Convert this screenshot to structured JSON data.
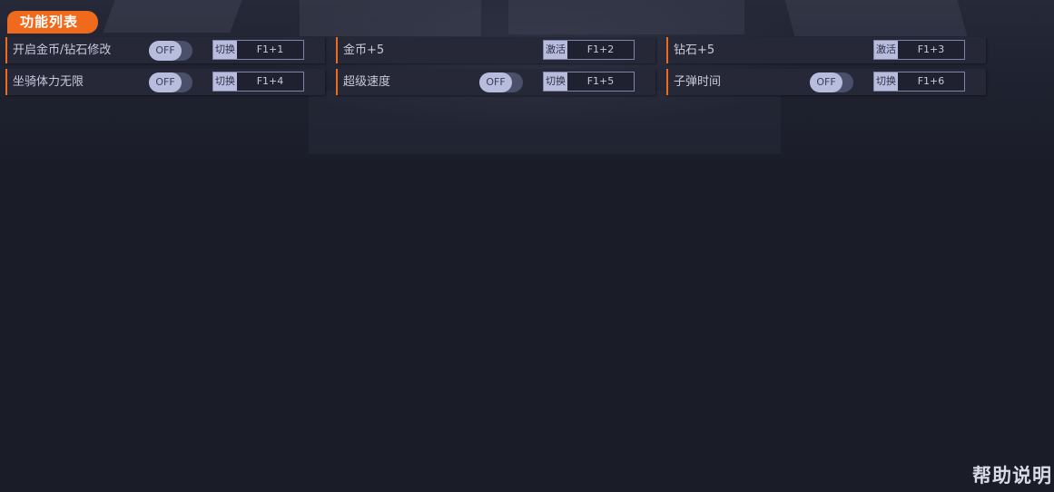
{
  "panel": {
    "title": "功能列表"
  },
  "features": [
    {
      "label": "开启金币/钻石修改",
      "has_toggle": true,
      "toggle_text": "OFF",
      "hotkey_action": "切换",
      "hotkey": "F1+1"
    },
    {
      "label": "金币+5",
      "has_toggle": false,
      "hotkey_action": "激活",
      "hotkey": "F1+2"
    },
    {
      "label": "钻石+5",
      "has_toggle": false,
      "hotkey_action": "激活",
      "hotkey": "F1+3"
    },
    {
      "label": "坐骑体力无限",
      "has_toggle": true,
      "toggle_text": "OFF",
      "hotkey_action": "切换",
      "hotkey": "F1+4"
    },
    {
      "label": "超级速度",
      "has_toggle": true,
      "toggle_text": "OFF",
      "hotkey_action": "切换",
      "hotkey": "F1+5"
    },
    {
      "label": "子弹时间",
      "has_toggle": true,
      "toggle_text": "OFF",
      "hotkey_action": "切换",
      "hotkey": "F1+6"
    }
  ],
  "footer": {
    "help_label": "帮助说明"
  },
  "colors": {
    "accent": "#f06a1e",
    "background": "#1a1c28",
    "row_bg": "#262838",
    "toggle_knob": "#b9bddd"
  }
}
